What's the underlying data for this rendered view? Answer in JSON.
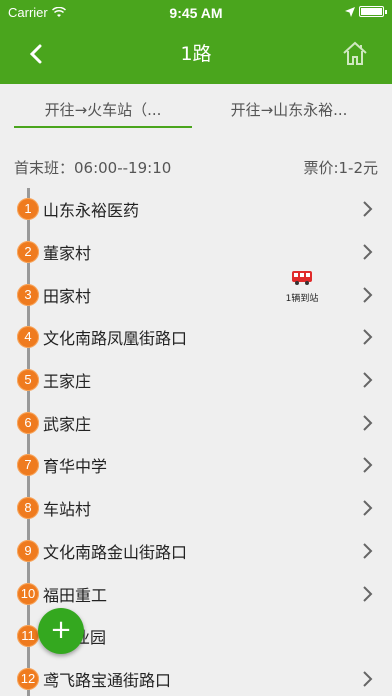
{
  "status_bar": {
    "carrier": "Carrier",
    "time": "9:45 AM"
  },
  "header": {
    "title": "1路",
    "back_icon": "chevron-left-icon",
    "home_icon": "home-icon"
  },
  "tabs": [
    {
      "label": "开往→火车站（...",
      "active": true
    },
    {
      "label": "开往→山东永裕...",
      "active": false
    }
  ],
  "info": {
    "times": "首末班：06:00--19:10",
    "price": "票价:1-2元"
  },
  "bus_indicator": {
    "icon": "bus-icon",
    "caption": "1辆到站",
    "stop_index": 3
  },
  "stops": [
    {
      "num": "1",
      "name": "山东永裕医药"
    },
    {
      "num": "2",
      "name": "董家村"
    },
    {
      "num": "3",
      "name": "田家村"
    },
    {
      "num": "4",
      "name": "文化南路凤凰街路口"
    },
    {
      "num": "5",
      "name": "王家庄"
    },
    {
      "num": "6",
      "name": "武家庄"
    },
    {
      "num": "7",
      "name": "育华中学"
    },
    {
      "num": "8",
      "name": "车站村"
    },
    {
      "num": "9",
      "name": "文化南路金山街路口"
    },
    {
      "num": "10",
      "name": "福田重工"
    },
    {
      "num": "11",
      "name": "工业园"
    },
    {
      "num": "12",
      "name": "鸢飞路宝通街路口"
    }
  ],
  "fab": {
    "label": "+"
  },
  "colors": {
    "brand_green": "#4aa51d",
    "stop_orange": "#ef7b1f",
    "bus_red": "#e02a2a"
  }
}
